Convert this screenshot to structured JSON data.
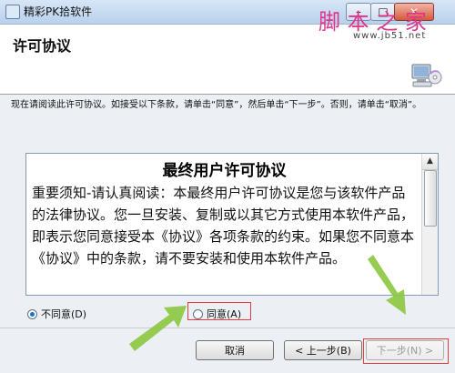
{
  "window": {
    "title": "精彩PK拾软件",
    "minimize_glyph": "–",
    "maximize_glyph": "□",
    "close_glyph": "✕"
  },
  "watermark": {
    "text": "脚 本 之 家",
    "url": "www.jb51.net"
  },
  "header": {
    "title": "许可协议",
    "icon": "computer-cd-icon"
  },
  "instructions": "现在请阅读此许可协议。如接受以下条款，请单击“同意”，然后单击“下一步”。否则，请单击“取消”。",
  "license": {
    "title": "最终用户许可协议",
    "body": "重要须知-请认真阅读：本最终用户许可协议是您与该软件产品的法律协议。您一旦安装、复制或以其它方式使用本软件产品，即表示您同意接受本《协议》各项条款的约束。如果您不同意本《协议》中的条款，请不要安装和使用本软件产品。",
    "scroll_up_glyph": "▲"
  },
  "options": {
    "disagree_label": "不同意(D)",
    "agree_label": "同意(A)",
    "selected": "disagree"
  },
  "buttons": {
    "cancel": "取消",
    "back": "< 上一步(B)",
    "next": "下一步(N) >"
  },
  "colors": {
    "highlight_red": "#e23c3c",
    "arrow_green": "#8cc63f"
  }
}
